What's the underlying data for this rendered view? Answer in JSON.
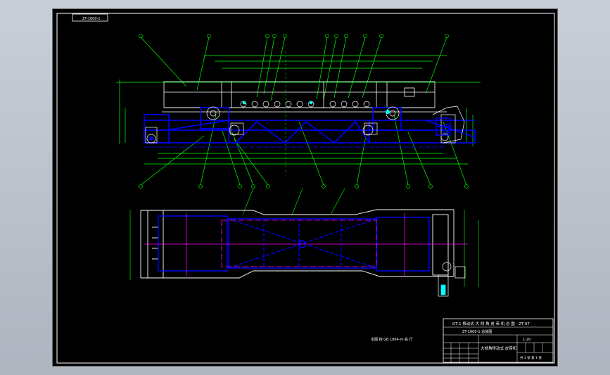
{
  "drawing": {
    "corner_code": "ZT-1000-1",
    "title_block": {
      "header": "DT-1 移动式 大 倾 角 皮 带 机 总 图 - ZT-07",
      "drawing_no": "ZT-1000-1-总装图",
      "part_name": "大倾角移动式 皮带机",
      "scale": "1:20",
      "sheet": "共 1 张 第 1 张"
    },
    "tech_note": "本图 按 GB 1804-m 执 行",
    "colors": {
      "background": "#000000",
      "frame": "#ffffff",
      "dimension": "#00ff00",
      "structure": "#0000ff",
      "centerline": "#ff00ff",
      "wire": "#ffffff",
      "highlight": "#00ffff"
    }
  }
}
